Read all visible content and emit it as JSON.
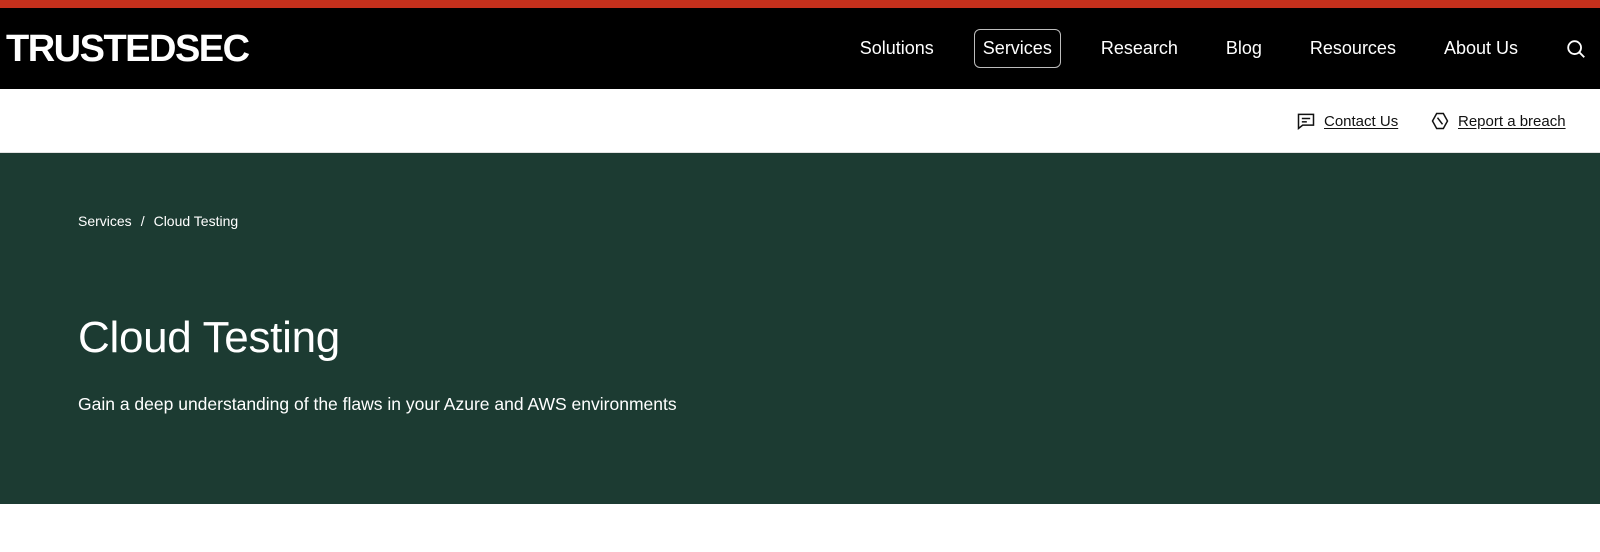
{
  "header": {
    "logo_text": "TRUSTEDSEC",
    "accent_color": "#c4301c",
    "nav_items": [
      {
        "label": "Solutions",
        "active": false
      },
      {
        "label": "Services",
        "active": true
      },
      {
        "label": "Research",
        "active": false
      },
      {
        "label": "Blog",
        "active": false
      },
      {
        "label": "Resources",
        "active": false
      },
      {
        "label": "About Us",
        "active": false
      }
    ],
    "search_icon": "search-icon"
  },
  "utility": {
    "contact_label": "Contact Us",
    "contact_icon": "chat-icon",
    "breach_label": "Report a breach",
    "breach_icon": "hexagon-alert-icon"
  },
  "breadcrumb": {
    "parent": "Services",
    "separator": "/",
    "current": "Cloud Testing"
  },
  "hero": {
    "title": "Cloud Testing",
    "subtitle": "Gain a deep understanding of the flaws in your Azure and AWS environments",
    "background_color": "#1c3b32"
  }
}
